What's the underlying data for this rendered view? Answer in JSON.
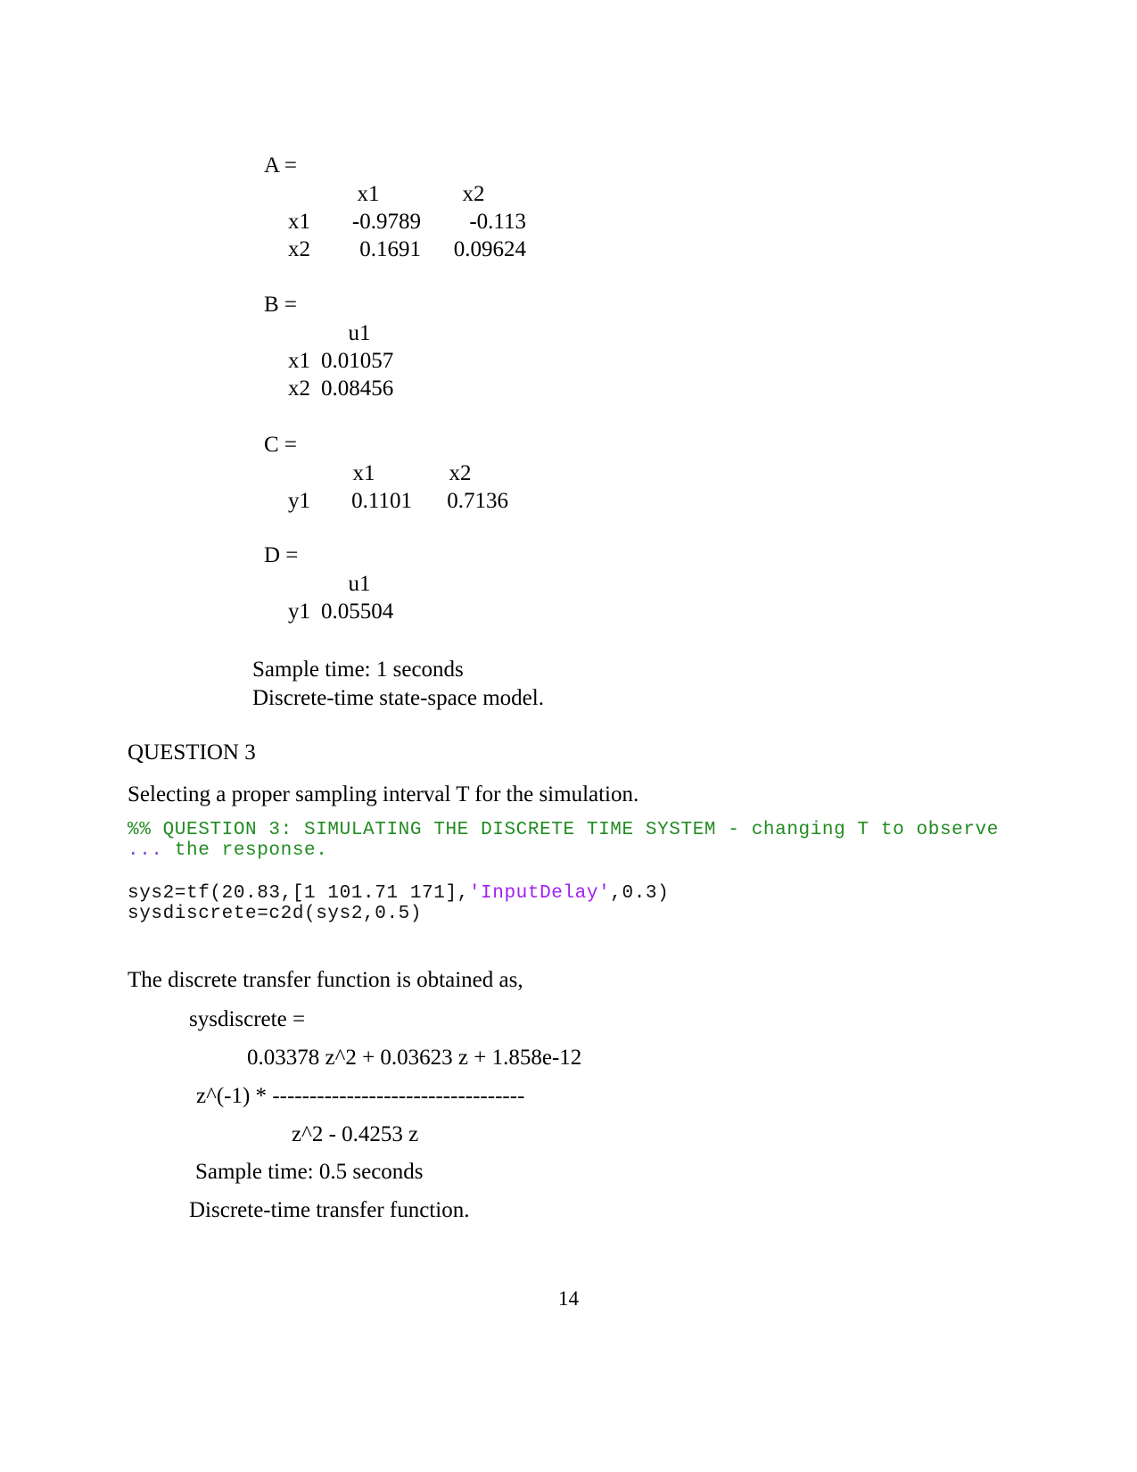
{
  "state_space": {
    "matrices": [
      {
        "name": "A =",
        "col_headers": [
          "x1",
          "x2"
        ],
        "rows": [
          {
            "label": "x1",
            "values": [
              "-0.9789",
              "-0.113"
            ]
          },
          {
            "label": "x2",
            "values": [
              "0.1691",
              "0.09624"
            ]
          }
        ]
      },
      {
        "name": "B =",
        "col_headers": [
          "u1"
        ],
        "rows": [
          {
            "label": "x1",
            "values": [
              "0.01057"
            ]
          },
          {
            "label": "x2",
            "values": [
              "0.08456"
            ]
          }
        ]
      },
      {
        "name": "C =",
        "col_headers": [
          "x1",
          "x2"
        ],
        "rows": [
          {
            "label": "y1",
            "values": [
              "0.1101",
              "0.7136"
            ]
          }
        ]
      },
      {
        "name": "D =",
        "col_headers": [
          "u1"
        ],
        "rows": [
          {
            "label": "y1",
            "values": [
              "0.05504"
            ]
          }
        ]
      }
    ],
    "sample_time": "Sample time: 1 seconds",
    "model_type": "Discrete-time state-space model."
  },
  "question": {
    "heading": "QUESTION 3",
    "description": "Selecting a proper sampling interval T for the simulation."
  },
  "code_block": {
    "comment_line_1_marker": "%%",
    "comment_line_1": " QUESTION 3: SIMULATING THE DISCRETE TIME SYSTEM - changing T to observe",
    "comment_line_2_ellipsis": "...",
    "comment_line_2": " the response.",
    "line_1_before_string": "sys2=tf(20.83,[1 101.71 171],",
    "line_1_string": "'InputDelay'",
    "line_1_after_string": ",0.3)",
    "line_2": "sysdiscrete=c2d(sys2,0.5)"
  },
  "result": {
    "intro": "The discrete transfer function is obtained as,",
    "var_name": "sysdiscrete =",
    "numerator": "0.03378 z^2 + 0.03623 z + 1.858e-12",
    "prefix": "z^(-1) * ",
    "fraction_bar": "----------------------------------",
    "denominator": "z^2 - 0.4253 z",
    "sample_time": "Sample time: 0.5 seconds",
    "model_type": "Discrete-time transfer function."
  },
  "footer": {
    "page_number": "14"
  }
}
